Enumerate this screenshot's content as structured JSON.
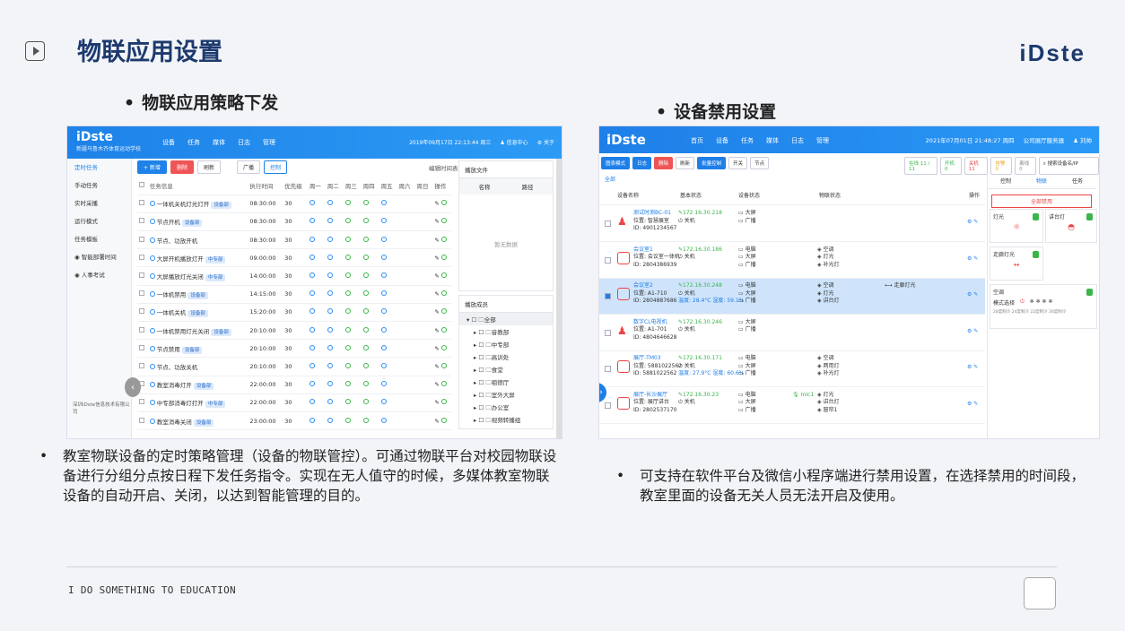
{
  "slide": {
    "title": "物联应用设置",
    "brand": "iDste",
    "sub_left": "物联应用策略下发",
    "sub_right": "设备禁用设置",
    "desc_left": "教室物联设备的定时策略管理（设备的物联管控）。可通过物联平台对校园物联设备进行分组分点按日程下发任务指令。实现在无人值守的时候，多媒体教室物联设备的自动开启、关闭，以达到智能管理的目的。",
    "desc_right": "可支持在软件平台及微信小程序端进行禁用设置，在选择禁用的时间段，教室里面的设备无关人员无法开启及使用。",
    "footer": "I DO SOMETHING TO EDUCATION",
    "bullet": "•"
  },
  "shot1": {
    "logo": "iDste",
    "school": "新疆乌鲁木齐体育运动学校",
    "menu": [
      "设备",
      "任务",
      "媒体",
      "日志",
      "管理"
    ],
    "datetime": "2019年09月17日 22:13:44 周三",
    "user": "信息中心",
    "about": "关于",
    "side": [
      "定时任务",
      "手动任务",
      "实时采播",
      "运行模式",
      "任务模板",
      "智能部署时间",
      "人事考试"
    ],
    "side_footer": "深圳iDste信息技术有限公司",
    "toolbar": {
      "add": "+ 新增",
      "del": "删除",
      "refresh": "刷新",
      "broadcast": "广播",
      "control": "控制",
      "edit_sched": "编辑时间表"
    },
    "headers": [
      "任务信息",
      "执行时间",
      "优先级",
      "周一",
      "周二",
      "周三",
      "周四",
      "周五",
      "周六",
      "周日",
      "操作"
    ],
    "rows": [
      {
        "name": "一体机关机灯光灯开",
        "tag": "设备部",
        "time": "08:30:00",
        "pri": "30"
      },
      {
        "name": "节点开机",
        "tag": "设备部",
        "time": "08:30:00",
        "pri": "30"
      },
      {
        "name": "节点、功放开机",
        "tag": "",
        "time": "08:30:00",
        "pri": "30"
      },
      {
        "name": "大屏开机播放灯开",
        "tag": "中专部",
        "time": "09:00:00",
        "pri": "30"
      },
      {
        "name": "大屏播放灯光关闭",
        "tag": "中专部",
        "time": "14:00:00",
        "pri": "30"
      },
      {
        "name": "一体机禁用",
        "tag": "设备部",
        "time": "14:15:00",
        "pri": "30"
      },
      {
        "name": "一体机关机",
        "tag": "设备部",
        "time": "15:20:00",
        "pri": "30"
      },
      {
        "name": "一体机禁用灯光关闭",
        "tag": "设备部",
        "time": "20:10:00",
        "pri": "30"
      },
      {
        "name": "节点禁用",
        "tag": "设备部",
        "time": "20:10:00",
        "pri": "30"
      },
      {
        "name": "节点、功放关机",
        "tag": "",
        "time": "20:10:00",
        "pri": "30"
      },
      {
        "name": "教室消毒灯开",
        "tag": "设备部",
        "time": "22:00:00",
        "pri": "30"
      },
      {
        "name": "中专部消毒灯打开",
        "tag": "中专部",
        "time": "22:00:00",
        "pri": "30"
      },
      {
        "name": "教室消毒关闭",
        "tag": "设备部",
        "time": "23:00:00",
        "pri": "30"
      }
    ],
    "media_title": "播放文件",
    "media_cols": [
      "名称",
      "路径"
    ],
    "empty": "暂无数据",
    "target_title": "播放成员",
    "tree": [
      "全部",
      "音教部",
      "中专部",
      "高训处",
      "食堂",
      "祖德厅",
      "室外大屏",
      "办公室",
      "视频转播组"
    ]
  },
  "shot2": {
    "logo": "iDste",
    "menu": [
      "首页",
      "设备",
      "任务",
      "媒体",
      "日志",
      "管理"
    ],
    "datetime": "2021年07月01日 21:48:27 周四",
    "dept": "公司展厅服务器",
    "user": "刘帅",
    "toolbar": [
      "图表模式",
      "日志",
      "删除",
      "刷新",
      "批量控制",
      "开关",
      "节点"
    ],
    "stats": [
      "在线 11 / 11",
      "开机 0",
      "关机 11",
      "告警 0",
      "离线 0"
    ],
    "search": "搜索设备名/IP",
    "tab": "全部",
    "headers": [
      "设备名称",
      "基本状态",
      "设备状态",
      "物联状态",
      "操作"
    ],
    "devices": [
      {
        "name": "测试时测BC-01",
        "loc": "位置: 智慧展室",
        "id": "ID: 4901234567",
        "ip": "172.16.30.218",
        "st": "关机",
        "dev": [
          "大屏",
          "广播"
        ],
        "iot": []
      },
      {
        "name": "会议室1",
        "loc": "位置: 会议室一体机",
        "id": "ID: 2804386939",
        "ip": "172.16.30.186",
        "st": "关机",
        "dev": [
          "电脑",
          "大屏",
          "广播"
        ],
        "iot": [
          "空调",
          "灯光",
          "补光灯"
        ]
      },
      {
        "name": "会议室2",
        "loc": "位置: A1-710",
        "id": "ID: 2804887686",
        "ip": "172.16.30.248",
        "st": "关机",
        "env": "温度: 28.4°C 湿度: 59.1%",
        "dev": [
          "电脑",
          "大屏",
          "广播"
        ],
        "iot": [
          "空调",
          "灯光",
          "讲台灯"
        ],
        "extra": "走廊灯光"
      },
      {
        "name": "数字CL电视机",
        "loc": "位置: A1-701",
        "id": "ID: 4804646628",
        "ip": "172.16.30.246",
        "st": "关机",
        "dev": [
          "大屏",
          "广播"
        ],
        "iot": []
      },
      {
        "name": "展厅-TM03",
        "loc": "位置: 5881022562",
        "id": "ID: 5881022562",
        "ip": "172.16.30.171",
        "st": "关机",
        "env": "温度: 27.9°C 湿度: 60.6%",
        "dev": [
          "电脑",
          "大屏",
          "广播"
        ],
        "iot": [
          "空调",
          "两用灯",
          "补光灯"
        ]
      },
      {
        "name": "展厅-长沙展厅",
        "loc": "位置: 展厅讲台",
        "id": "ID: 2802537170",
        "ip": "172.16.30.23",
        "st": "关机",
        "dev": [
          "电脑",
          "大屏",
          "广播"
        ],
        "mic": "mic1",
        "iot": [
          "灯光",
          "讲台灯",
          "窗帘1"
        ]
      }
    ],
    "right_tabs": [
      "控制",
      "物联",
      "任务"
    ],
    "disable_all": "全部禁用",
    "cards": [
      "灯光",
      "讲台灯",
      "走廊灯光",
      "空调"
    ],
    "mode": "模式选择",
    "ac_note": "28度制冷 24度制冷 22度制冷 26度制冷"
  }
}
